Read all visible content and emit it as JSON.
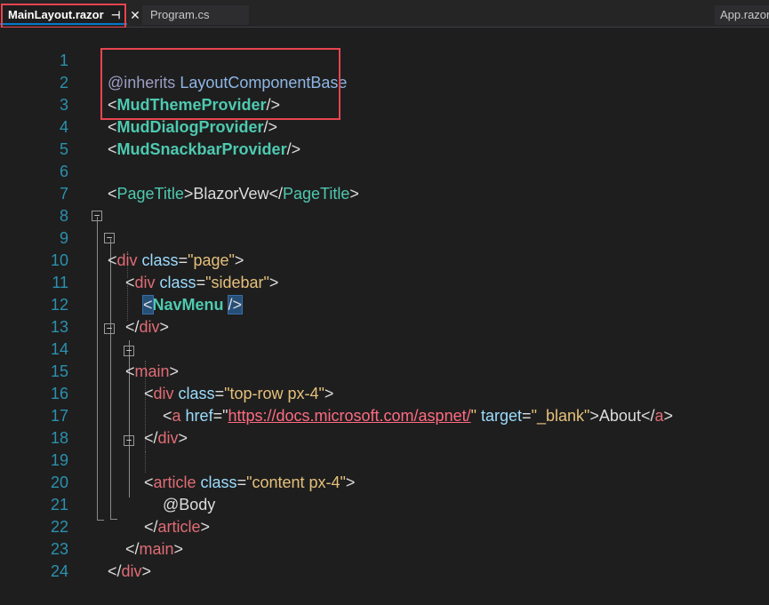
{
  "tabs": [
    {
      "label": "MainLayout.razor",
      "active": true,
      "pinned": true
    },
    {
      "label": "Program.cs",
      "active": false
    },
    {
      "label": "App.razor",
      "active": false
    }
  ],
  "icons": {
    "pin": "pin-icon",
    "close": "close-icon",
    "collapse": "collapse-toggle-icon"
  },
  "colors": {
    "highlight_box": "#e8454f",
    "line_numbers": "#2b91af",
    "component": "#4ec9b0",
    "string": "#e5c07b"
  },
  "line_numbers": [
    "1",
    "2",
    "3",
    "4",
    "5",
    "6",
    "7",
    "8",
    "9",
    "10",
    "11",
    "12",
    "13",
    "14",
    "15",
    "16",
    "17",
    "18",
    "19",
    "20",
    "21",
    "22",
    "23",
    "24"
  ],
  "code": {
    "l1": {
      "directive": "@inherits",
      "base": " LayoutComponentBase"
    },
    "l2": {
      "tag": "MudThemeProvider"
    },
    "l3": {
      "tag": "MudDialogProvider"
    },
    "l4": {
      "tag": "MudSnackbarProvider"
    },
    "l6": {
      "tag": "PageTitle",
      "text": "BlazorVew"
    },
    "l9": {
      "tag": "div",
      "attr": "class",
      "value": "\"page\""
    },
    "l10": {
      "tag": "div",
      "attr": "class",
      "value": "\"sidebar\""
    },
    "l11": {
      "tag": "NavMenu"
    },
    "l12": {
      "tag": "div"
    },
    "l14": {
      "tag": "main"
    },
    "l15": {
      "tag": "div",
      "attr": "class",
      "value": "\"top-row px-4\""
    },
    "l16": {
      "tag": "a",
      "attr1": "href",
      "url": "https://docs.microsoft.com/aspnet/",
      "attr2": "target",
      "value2": "\"_blank\"",
      "text": "About"
    },
    "l17": {
      "tag": "div"
    },
    "l19": {
      "tag": "article",
      "attr": "class",
      "value": "\"content px-4\""
    },
    "l20": {
      "text": "@Body"
    },
    "l21": {
      "tag": "article"
    },
    "l22": {
      "tag": "main"
    },
    "l23": {
      "tag": "div"
    }
  }
}
